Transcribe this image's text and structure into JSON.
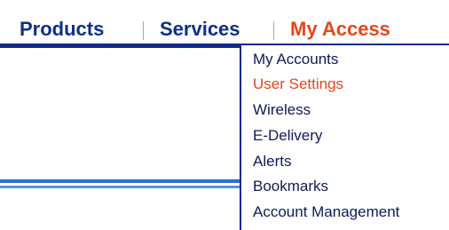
{
  "nav": {
    "products_label": "Products",
    "services_label": "Services",
    "my_access_label": "My Access",
    "active": "My Access",
    "colors": {
      "primary": "#0d2f8a",
      "active": "#e8461a",
      "rule": "#102a8c"
    }
  },
  "dropdown": {
    "items": [
      {
        "label": "My Accounts"
      },
      {
        "label": "User Settings",
        "active": true
      },
      {
        "label": "Wireless"
      },
      {
        "label": "E-Delivery"
      },
      {
        "label": "Alerts"
      },
      {
        "label": "Bookmarks"
      },
      {
        "label": "Account Management"
      }
    ]
  }
}
